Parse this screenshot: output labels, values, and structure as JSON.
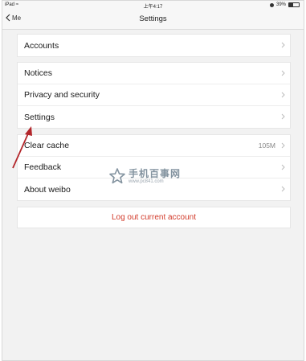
{
  "status_bar": {
    "device": "iPad",
    "time": "上午4:17",
    "battery_percent": "39%",
    "battery_level": 0.39
  },
  "nav": {
    "back_label": "Me",
    "title": "Settings"
  },
  "groups": [
    {
      "rows": [
        {
          "label": "Accounts"
        }
      ]
    },
    {
      "rows": [
        {
          "label": "Notices"
        },
        {
          "label": "Privacy and security"
        },
        {
          "label": "Settings"
        }
      ]
    },
    {
      "rows": [
        {
          "label": "Clear cache",
          "value": "105M"
        },
        {
          "label": "Feedback"
        },
        {
          "label": "About weibo"
        }
      ]
    }
  ],
  "logout_label": "Log out current account",
  "watermark": {
    "name": "手机百事网",
    "url": "www.pc841.com"
  },
  "colors": {
    "logout": "#d23a2a",
    "annotation_arrow": "#b3262b"
  }
}
